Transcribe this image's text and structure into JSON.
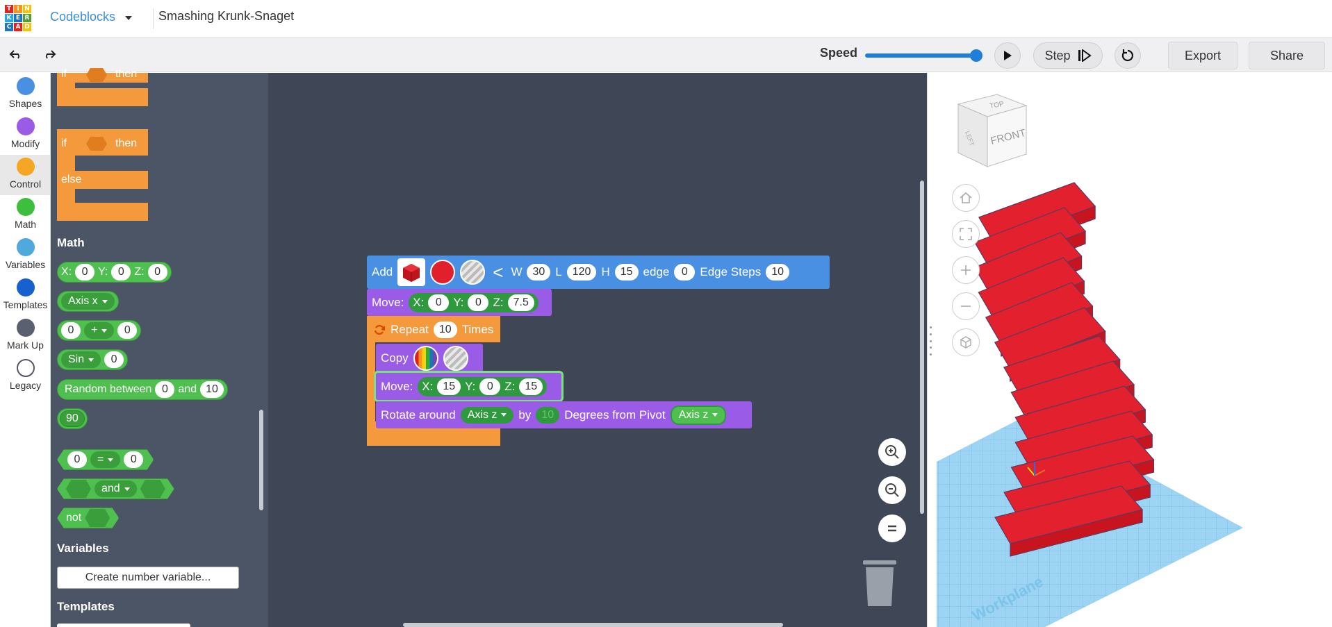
{
  "header": {
    "logo_letters": [
      "T",
      "I",
      "N",
      "K",
      "E",
      "R",
      "C",
      "A",
      "D"
    ],
    "logo_colors": [
      "#e2231a",
      "#f7941d",
      "#f5c20b",
      "#27a9e1",
      "#1d75bc",
      "#4f9e38",
      "#1d75bc",
      "#e2231a",
      "#f5c20b"
    ],
    "app_switcher": "Codeblocks",
    "doc_title": "Smashing Krunk-Snaget"
  },
  "toolbar": {
    "undo_icon": "undo-arrow-icon",
    "redo_icon": "redo-arrow-icon",
    "speed_label": "Speed",
    "speed_value": 1.0,
    "step_label": "Step",
    "export_label": "Export",
    "share_label": "Share",
    "accent": "#1f7fd8"
  },
  "categories": [
    {
      "label": "Shapes",
      "color": "#4a90e2"
    },
    {
      "label": "Modify",
      "color": "#9a5ce6"
    },
    {
      "label": "Control",
      "color": "#f5a623"
    },
    {
      "label": "Math",
      "color": "#3cbf3c"
    },
    {
      "label": "Variables",
      "color": "#4fa9dd"
    },
    {
      "label": "Templates",
      "color": "#1760d0"
    },
    {
      "label": "Mark Up",
      "color": "#5a6070"
    },
    {
      "label": "Legacy",
      "color": "#ffffff"
    }
  ],
  "flyout": {
    "control_blocks": {
      "if": "if",
      "then": "then",
      "else": "else"
    },
    "math_title": "Math",
    "math_xyz": {
      "x_label": "X:",
      "x": "0",
      "y_label": "Y:",
      "y": "0",
      "z_label": "Z:",
      "z": "0"
    },
    "math_axis": "Axis x",
    "math_arith": {
      "a": "0",
      "op": "+",
      "b": "0"
    },
    "math_sin": {
      "fn": "Sin",
      "v": "0"
    },
    "math_random": {
      "label": "Random between",
      "a": "0",
      "and": "and",
      "b": "10"
    },
    "math_number": "90",
    "math_compare": {
      "a": "0",
      "op": "=",
      "b": "0"
    },
    "math_and": "and",
    "math_not": "not",
    "variables_title": "Variables",
    "create_variable": "Create number variable...",
    "templates_title": "Templates"
  },
  "workspace": {
    "add_block": {
      "label": "Add",
      "arrow": "<",
      "w_label": "W",
      "w": "30",
      "l_label": "L",
      "l": "120",
      "h_label": "H",
      "h": "15",
      "edge_label": "edge",
      "edge": "0",
      "steps_label": "Edge Steps",
      "steps": "10"
    },
    "move1": {
      "label": "Move:",
      "x_label": "X:",
      "x": "0",
      "y_label": "Y:",
      "y": "0",
      "z_label": "Z:",
      "z": "7.5"
    },
    "repeat": {
      "label": "Repeat",
      "count": "10",
      "times": "Times"
    },
    "copy": {
      "label": "Copy"
    },
    "move2": {
      "label": "Move:",
      "x_label": "X:",
      "x": "15",
      "y_label": "Y:",
      "y": "0",
      "z_label": "Z:",
      "z": "15"
    },
    "rotate": {
      "label": "Rotate around",
      "axis": "Axis z",
      "by": "by",
      "deg_value": "10",
      "degrees": "Degrees from Pivot",
      "pivot": "Axis z"
    }
  },
  "viewport": {
    "viewcube_top": "TOP",
    "viewcube_front": "FRONT",
    "viewcube_left": "LEFT",
    "workplane_label": "Workplane"
  }
}
